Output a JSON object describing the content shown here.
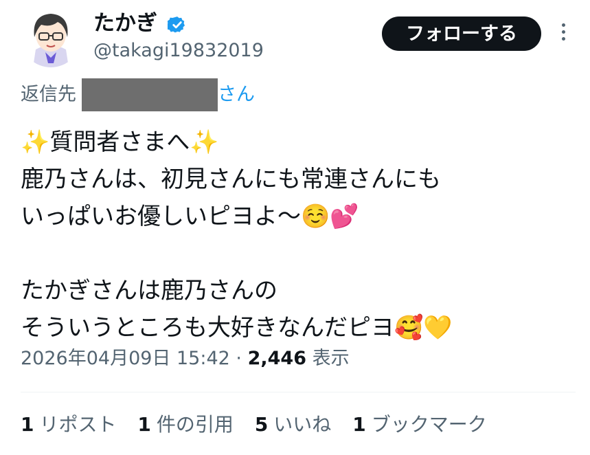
{
  "author": {
    "display_name": "たかぎ",
    "handle": "@takagi19832019",
    "verified": true,
    "avatar_icon": "anime-character-avatar"
  },
  "header": {
    "follow_label": "フォローする",
    "more_icon": "more-vertical-icon"
  },
  "reply": {
    "prefix": "返信先",
    "suffix": "さん"
  },
  "tweet": {
    "lines": [
      "✨質問者さまへ✨",
      "鹿乃さんは、初見さんにも常連さんにも",
      "いっぱいお優しいピヨよ〜☺️💕",
      "",
      "たかぎさんは鹿乃さんの",
      "そういうところも大好きなんだピヨ🥰💛"
    ]
  },
  "meta": {
    "timestamp": "2026年04月09日 15:42",
    "separator": " · ",
    "views_count": "2,446",
    "views_label": "表示"
  },
  "stats": [
    {
      "count": "1",
      "label": "リポスト"
    },
    {
      "count": "1",
      "label": "件の引用"
    },
    {
      "count": "5",
      "label": "いいね"
    },
    {
      "count": "1",
      "label": "ブックマーク"
    }
  ],
  "colors": {
    "text": "#0f1419",
    "secondary": "#536471",
    "link": "#1d9bf0",
    "verified": "#1d9bf0",
    "button_bg": "#0f1419",
    "redaction": "#6e6e6e"
  }
}
